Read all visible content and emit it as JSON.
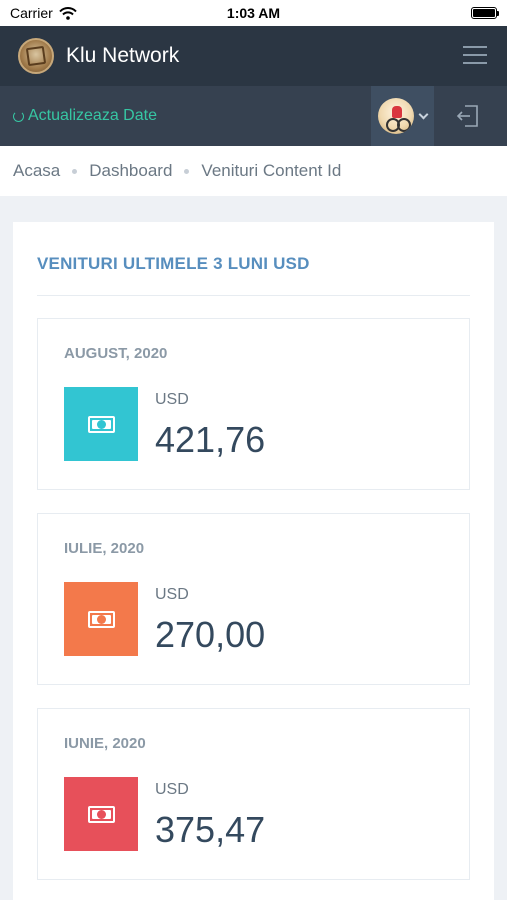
{
  "status_bar": {
    "carrier": "Carrier",
    "time": "1:03 AM"
  },
  "header": {
    "title": "Klu Network"
  },
  "subheader": {
    "refresh_label": "Actualizeaza Date"
  },
  "breadcrumb": [
    "Acasa",
    "Dashboard",
    "Venituri Content Id"
  ],
  "portlet": {
    "title": "VENITURI ULTIMELE 3 LUNI USD"
  },
  "stats": [
    {
      "month": "AUGUST, 2020",
      "currency": "USD",
      "value": "421,76",
      "color": "#32c5d2"
    },
    {
      "month": "IULIE, 2020",
      "currency": "USD",
      "value": "270,00",
      "color": "#f3794b"
    },
    {
      "month": "IUNIE, 2020",
      "currency": "USD",
      "value": "375,47",
      "color": "#e7505a"
    }
  ],
  "colors": {
    "topbar": "#2b3643",
    "subbar": "#364150",
    "accent_green": "#36c6a3",
    "title_blue": "#578ebe"
  },
  "icons": [
    "wifi-icon",
    "battery-icon",
    "app-logo",
    "hamburger-icon",
    "refresh-icon",
    "avatar",
    "chevron-down-icon",
    "logout-icon",
    "money-icon"
  ]
}
